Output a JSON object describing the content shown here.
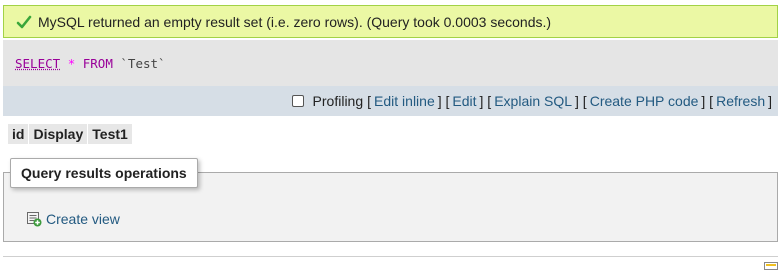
{
  "status": {
    "message": "MySQL returned an empty result set (i.e. zero rows). (Query took 0.0003 seconds.)",
    "icon": "checkmark-icon",
    "color": "#ebf8a4"
  },
  "sql": {
    "select": "SELECT",
    "star": "*",
    "from": "FROM",
    "table": "`Test`"
  },
  "toolbar": {
    "profiling_label": "Profiling",
    "profiling_checked": false,
    "links": [
      "Edit inline",
      "Edit",
      "Explain SQL",
      "Create PHP code",
      "Refresh"
    ]
  },
  "columns": [
    "id",
    "Display",
    "Test1"
  ],
  "operations": {
    "title": "Query results operations",
    "create_view_label": "Create view",
    "create_view_icon": "create-view-icon"
  },
  "colors": {
    "link": "#235a81",
    "sql_keyword": "#990099",
    "toolbar_bg": "#d6dee6"
  }
}
